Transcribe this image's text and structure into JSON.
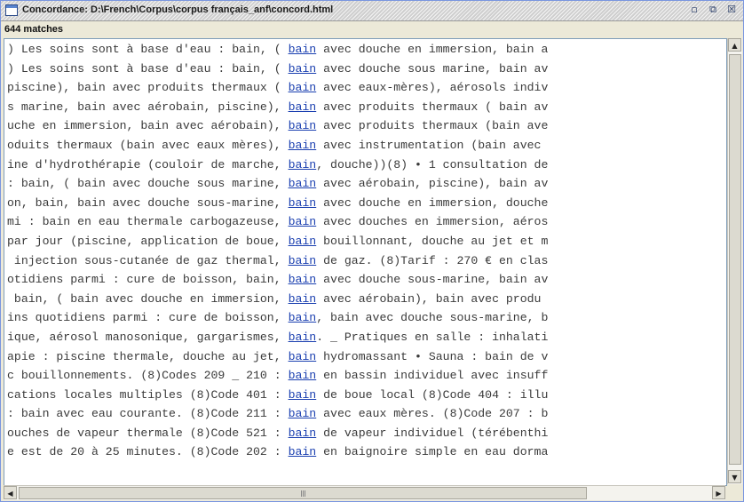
{
  "window": {
    "title": "Concordance: D:\\French\\Corpus\\corpus français_anf\\concord.html",
    "controls": {
      "restore": "▫",
      "maximize": "⧉",
      "close": "☒"
    }
  },
  "header": {
    "match_count": "644 matches"
  },
  "concordance": {
    "keyword_color": "#1a3fb0",
    "lines": [
      {
        "left": ") Les soins sont à base d'eau : bain, ( ",
        "kw": "bain",
        "right": " avec douche en immersion, bain a"
      },
      {
        "left": ") Les soins sont à base d'eau : bain, ( ",
        "kw": "bain",
        "right": " avec douche sous marine, bain av"
      },
      {
        "left": "piscine), bain avec produits thermaux ( ",
        "kw": "bain",
        "right": " avec eaux-mères), aérosols indiv"
      },
      {
        "left": "s marine, bain avec aérobain, piscine), ",
        "kw": "bain",
        "right": " avec produits thermaux ( bain av"
      },
      {
        "left": "uche en immersion, bain avec aérobain), ",
        "kw": "bain",
        "right": " avec produits thermaux (bain ave"
      },
      {
        "left": "oduits thermaux (bain avec eaux mères), ",
        "kw": "bain",
        "right": " avec instrumentation (bain avec"
      },
      {
        "left": "ine d'hydrothérapie (couloir de marche, ",
        "kw": "bain",
        "right": ", douche))(8) • 1 consultation de"
      },
      {
        "left": ": bain, ( bain avec douche sous marine, ",
        "kw": "bain",
        "right": " avec aérobain, piscine), bain av"
      },
      {
        "left": "on, bain, bain avec douche sous-marine, ",
        "kw": "bain",
        "right": " avec douche en immersion, douche"
      },
      {
        "left": "mi : bain en eau thermale carbogazeuse, ",
        "kw": "bain",
        "right": " avec douches en immersion, aéros"
      },
      {
        "left": "par jour (piscine, application de boue, ",
        "kw": "bain",
        "right": " bouillonnant, douche au jet et m"
      },
      {
        "left": " injection sous-cutanée de gaz thermal, ",
        "kw": "bain",
        "right": " de gaz. (8)Tarif : 270 € en clas"
      },
      {
        "left": "otidiens parmi : cure de boisson, bain, ",
        "kw": "bain",
        "right": " avec douche sous-marine, bain av"
      },
      {
        "left": " bain, ( bain avec douche en immersion, ",
        "kw": "bain",
        "right": " avec aérobain), bain avec produ"
      },
      {
        "left": "ins quotidiens parmi : cure de boisson, ",
        "kw": "bain",
        "right": ", bain avec douche sous-marine, b"
      },
      {
        "left": "ique, aérosol manosonique, gargarismes, ",
        "kw": "bain",
        "right": ". _ Pratiques en salle : inhalati"
      },
      {
        "left": "apie : piscine thermale, douche au jet, ",
        "kw": "bain",
        "right": " hydromassant • Sauna : bain de v"
      },
      {
        "left": "c bouillonnements. (8)Codes 209 _ 210 : ",
        "kw": "bain",
        "right": " en bassin individuel avec insuff"
      },
      {
        "left": "cations locales multiples (8)Code 401 : ",
        "kw": "bain",
        "right": " de boue local (8)Code 404 : illu"
      },
      {
        "left": ": bain avec eau courante. (8)Code 211 : ",
        "kw": "bain",
        "right": " avec eaux mères. (8)Code 207 : b"
      },
      {
        "left": "ouches de vapeur thermale (8)Code 521 : ",
        "kw": "bain",
        "right": " de vapeur individuel (térébenthi"
      },
      {
        "left": "e est de 20 à 25 minutes. (8)Code 202 : ",
        "kw": "bain",
        "right": " en baignoire simple en eau dorma"
      }
    ]
  },
  "scrollbars": {
    "vertical": {
      "up_arrow": "▲",
      "down_arrow": "▼"
    },
    "horizontal": {
      "left_arrow": "◀",
      "right_arrow": "▶"
    }
  }
}
